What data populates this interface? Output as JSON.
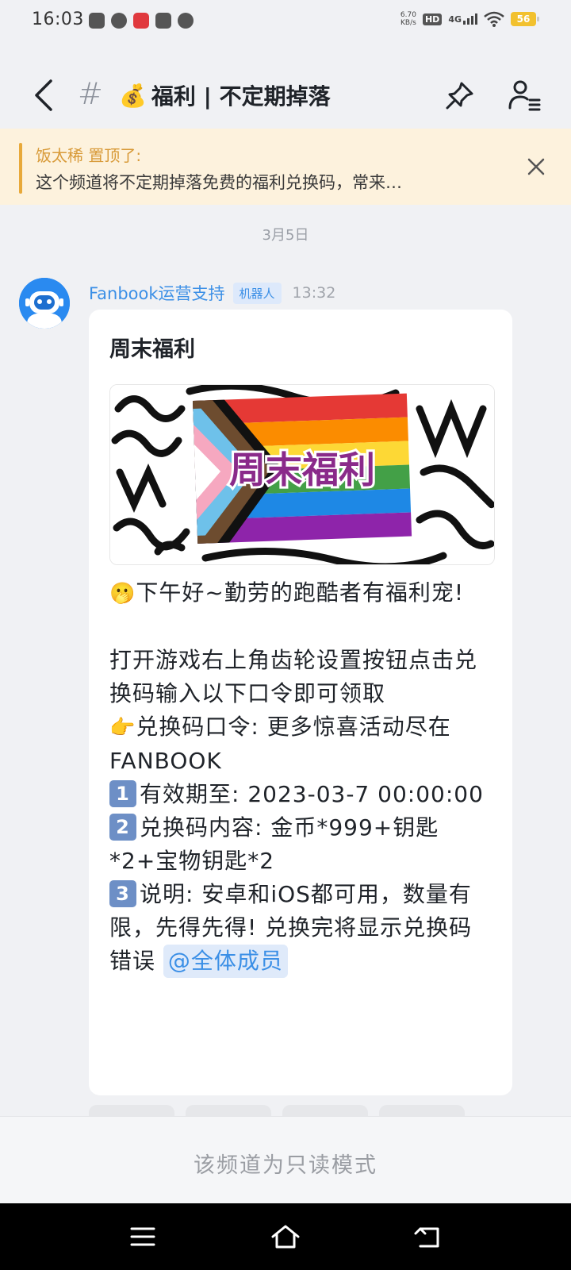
{
  "status_bar": {
    "time": "16:03",
    "net_speed_value": "6.70",
    "net_speed_unit": "KB/s",
    "hd_label": "HD",
    "network_label": "4G",
    "battery": "56"
  },
  "header": {
    "hash": "#",
    "emoji": "💰",
    "title": "福利 | 不定期掉落"
  },
  "pinned": {
    "title": "饭太稀 置顶了:",
    "text": "这个频道将不定期掉落免费的福利兑换码，常来…"
  },
  "date_separator": "3月5日",
  "message": {
    "sender_name": "Fanbook运营支持",
    "badge": "机器人",
    "time": "13:32",
    "card_title": "周末福利",
    "banner_text": "周末福利",
    "greeting_emoji": "🫢",
    "greeting": "下午好~勤劳的跑酷者有福利宠!",
    "instruction": "打开游戏右上角齿轮设置按钮点击兑换码输入以下口令即可领取",
    "code_emoji": "👉",
    "code_line": "兑换码口令: 更多惊喜活动尽在FANBOOK",
    "items": [
      {
        "num": "1",
        "text": "有效期至: 2023-03-7 00:00:00"
      },
      {
        "num": "2",
        "text": "兑换码内容: 金币*999+钥匙*2+宝物钥匙*2"
      },
      {
        "num": "3",
        "text": "说明: 安卓和iOS都可用，数量有限，先得先得! 兑换完将显示兑换码错误"
      }
    ],
    "mention": "@全体成员"
  },
  "readonly_text": "该频道为只读模式",
  "colors": {
    "accent_blue": "#3b8fe6",
    "pinned_bg": "#fdf2dd",
    "pinned_accent": "#e8a93a"
  }
}
